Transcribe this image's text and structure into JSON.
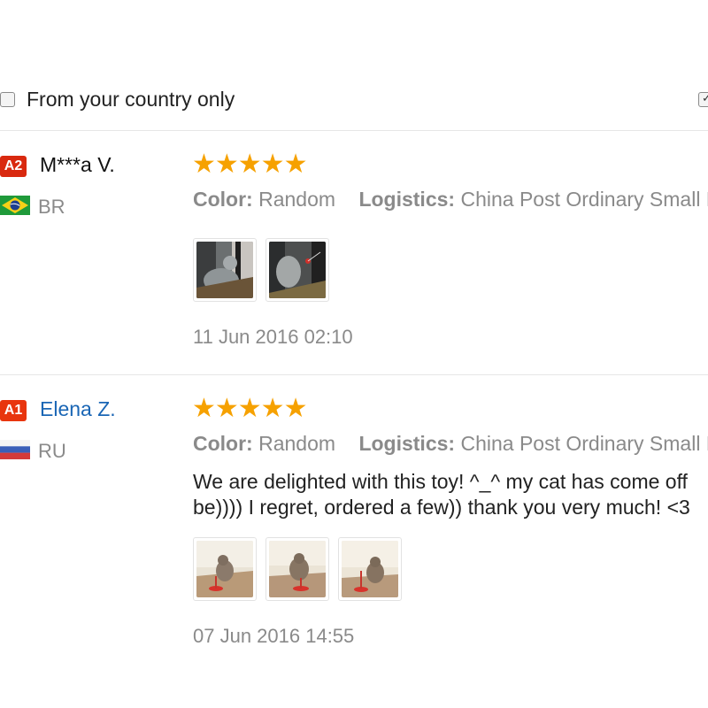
{
  "filter": {
    "country_only_label": "From your country only",
    "country_only_checked": false,
    "right_checkbox_checked": true
  },
  "reviews": [
    {
      "level_badge": "A2",
      "reviewer": "M***a V.",
      "country": "BR",
      "flag_icon": "brazil-flag-icon",
      "rating": 5,
      "stars": "★★★★★",
      "color_key": "Color:",
      "color_value": "Random",
      "logistics_key": "Logistics:",
      "logistics_value": "China Post Ordinary Small Pa",
      "text_line1": "",
      "text_line2": "",
      "photos": [
        "cat-photo-1",
        "cat-photo-2"
      ],
      "date": "11 Jun 2016 02:10"
    },
    {
      "level_badge": "A1",
      "reviewer": "Elena Z.",
      "country": "RU",
      "flag_icon": "russia-flag-icon",
      "rating": 5,
      "stars": "★★★★★",
      "color_key": "Color:",
      "color_value": "Random",
      "logistics_key": "Logistics:",
      "logistics_value": "China Post Ordinary Small Pa",
      "text_line1": "We are delighted with this toy! ^_^ my cat has come off",
      "text_line2": "be)))) I regret, ordered a few)) thank you very much! <3",
      "photos": [
        "cat-photo-3",
        "cat-photo-4",
        "cat-photo-5"
      ],
      "date": "07 Jun 2016 14:55"
    }
  ],
  "colors": {
    "star": "#f6a100",
    "badge_a2": "#d9290f",
    "badge_a1": "#e8350e",
    "link": "#1a66b5",
    "muted": "#8a8a8a"
  }
}
